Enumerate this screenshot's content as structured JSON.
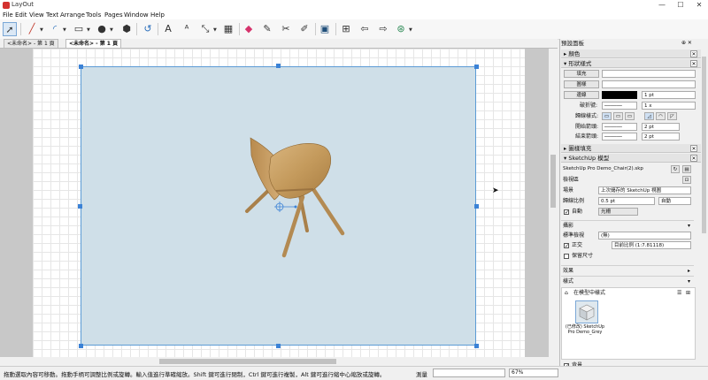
{
  "app": {
    "title": "LayOut"
  },
  "window_controls": {
    "minimize": "—",
    "maximize": "☐",
    "close": "✕"
  },
  "menu": [
    "File",
    "Edit",
    "View",
    "Text",
    "Arrange",
    "Tools",
    "Pages",
    "Window",
    "Help"
  ],
  "toolbar": {
    "tools": [
      "select-tool",
      "line-tool",
      "arc-tool",
      "rectangle-tool",
      "circle-tool",
      "polygon-tool",
      "offset-tool",
      "text-tool",
      "label-tool",
      "dimension-tool",
      "table-tool",
      "eraser-tool",
      "style-tool",
      "split-tool",
      "join-tool",
      "present-tool",
      "add-page-tool",
      "previous-page-tool",
      "next-page-tool",
      "screen-share-tool"
    ]
  },
  "tabs": [
    {
      "label": "<未命名> - 第 1 頁"
    },
    {
      "label": "<未命名> - 第 1 頁"
    }
  ],
  "status": {
    "hint": "拖動選取內容可移動。拖動手柄可調整比例或旋轉。輸入值進行準確縮放。Shift 鍵可進行閉制，Ctrl 鍵可進行複製，Alt 鍵可進行縮中心縮放或旋轉。",
    "measure_label": "測量",
    "measure_value": "",
    "zoom": "67%"
  },
  "panel": {
    "tray_title": "預設面板",
    "colors_title": "顏色",
    "shape_style": {
      "title": "形狀樣式",
      "fill_button": "填充",
      "pattern_button": "圖樣",
      "stroke_button": "邊線",
      "stroke_width": "1 pt",
      "dash_label": "破折號:",
      "dash_scale": "1 x",
      "cap_label": "歸線樣式:",
      "start_label": "開始箭頭:",
      "start_size": "2 pt",
      "end_label": "結束箭頭:",
      "end_size": "2 pt",
      "stroke_color": "#000000"
    },
    "pattern_fill_title": "圖樣填充",
    "sketchup_model": {
      "title": "SketchUp 模型",
      "file": "SketchUp Pro Demo_Chair(2).skp",
      "view_section": "檢視區",
      "scene_label": "場景",
      "scene_value": "上次儲存的 SketchUp 視圖",
      "line_scale_label": "歸線比例",
      "line_scale_value": "0.5 pt",
      "auto_value": "自動",
      "auto_label": "自動",
      "raster_value": "光柵",
      "camera_section": "攝影",
      "standard_view_label": "標準檢視",
      "standard_view_value": "(無)",
      "ortho_label": "正交",
      "ortho_value": "目前比例 (1:7.81118)",
      "preserve_label": "保留尺寸",
      "effects_label": "效果",
      "styles_label": "樣式",
      "in_model_styles": "在模型中樣式",
      "style_name": "(已修改) SketchUp Pro Demo_Grey",
      "background_label": "背景"
    }
  }
}
